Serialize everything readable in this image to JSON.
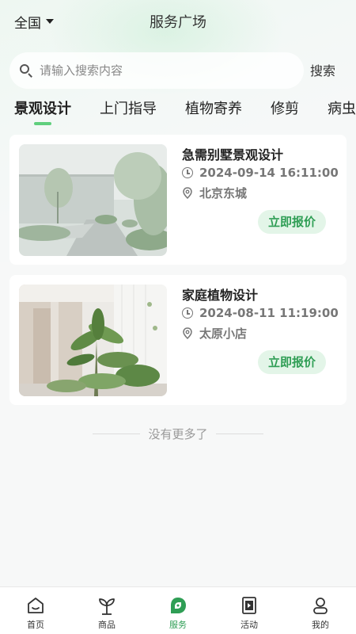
{
  "header": {
    "region": "全国",
    "title": "服务广场"
  },
  "search": {
    "placeholder": "请输入搜索内容",
    "button": "搜索"
  },
  "tabs": [
    {
      "label": "景观设计",
      "active": true
    },
    {
      "label": "上门指导"
    },
    {
      "label": "植物寄养"
    },
    {
      "label": "修剪"
    },
    {
      "label": "病虫"
    }
  ],
  "cards": [
    {
      "title": "急需别墅景观设计",
      "time": "2024-09-14 16:11:00",
      "location": "北京东城",
      "action": "立即报价"
    },
    {
      "title": "家庭植物设计",
      "time": "2024-08-11 11:19:00",
      "location": "太原小店",
      "action": "立即报价"
    }
  ],
  "list_footer": "没有更多了",
  "tabbar": [
    {
      "label": "首页",
      "icon": "home-icon"
    },
    {
      "label": "商品",
      "icon": "sprout-icon"
    },
    {
      "label": "服务",
      "icon": "service-icon",
      "active": true
    },
    {
      "label": "活动",
      "icon": "activity-icon"
    },
    {
      "label": "我的",
      "icon": "user-icon"
    }
  ],
  "colors": {
    "accent": "#5fcf7d",
    "button_bg": "#e3f5e8",
    "button_text": "#2f9e55"
  }
}
